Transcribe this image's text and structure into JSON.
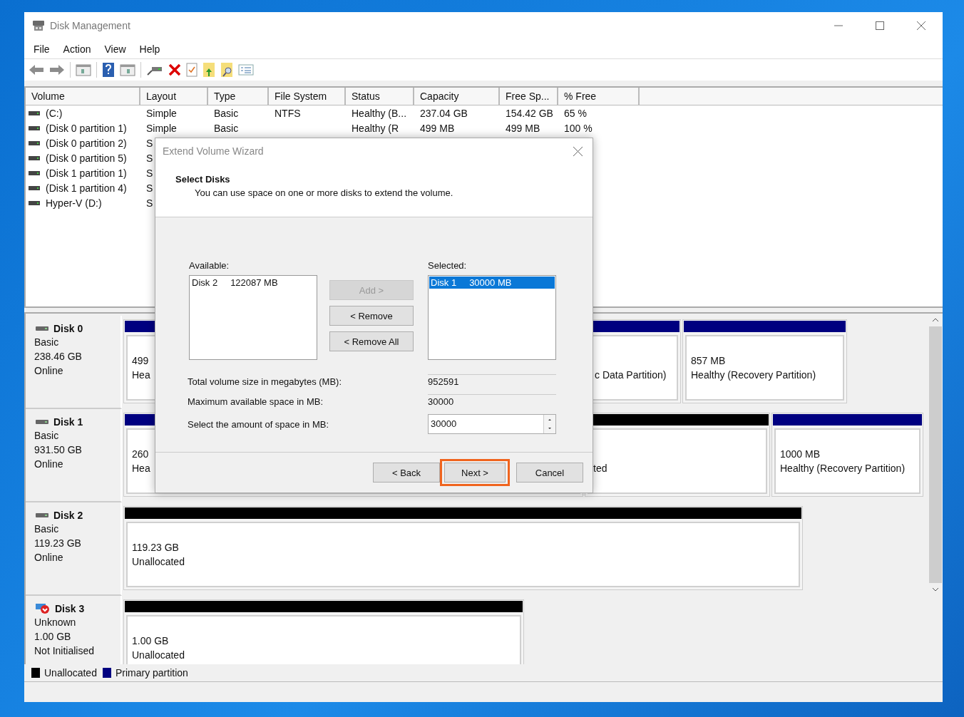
{
  "window": {
    "title": "Disk Management"
  },
  "menu": [
    "File",
    "Action",
    "View",
    "Help"
  ],
  "volumes": {
    "columns": [
      "Volume",
      "Layout",
      "Type",
      "File System",
      "Status",
      "Capacity",
      "Free Sp...",
      "% Free"
    ],
    "rows": [
      {
        "cells": [
          "(C:)",
          "Simple",
          "Basic",
          "NTFS",
          "Healthy (B...",
          "237.04 GB",
          "154.42 GB",
          "65 %"
        ]
      },
      {
        "cells": [
          "(Disk 0 partition 1)",
          "Simple",
          "Basic",
          "",
          "Healthy (R",
          "499 MB",
          "499 MB",
          "100 %"
        ]
      },
      {
        "cells": [
          "(Disk 0 partition 2)",
          "S"
        ]
      },
      {
        "cells": [
          "(Disk 0 partition 5)",
          "S"
        ]
      },
      {
        "cells": [
          "(Disk 1 partition 1)",
          "S"
        ]
      },
      {
        "cells": [
          "(Disk 1 partition 4)",
          "S"
        ]
      },
      {
        "cells": [
          "Hyper-V (D:)",
          "S"
        ]
      }
    ]
  },
  "disks": [
    {
      "name": "Disk 0",
      "kind": "online",
      "lines": [
        "Basic",
        "238.46 GB",
        "Online"
      ],
      "partitions": [
        {
          "color": "#000080",
          "size": "499",
          "status": "Hea"
        },
        {
          "color": "#000080",
          "status": "c Data Partition)"
        },
        {
          "color": "#000080",
          "size": "857 MB",
          "status": "Healthy (Recovery Partition)"
        }
      ]
    },
    {
      "name": "Disk 1",
      "kind": "online",
      "lines": [
        "Basic",
        "931.50 GB",
        "Online"
      ],
      "partitions": [
        {
          "color": "#000080",
          "size": "260",
          "status": "Hea"
        },
        {
          "color": "#000000",
          "status": "ted"
        },
        {
          "color": "#000080",
          "size": "1000 MB",
          "status": "Healthy (Recovery Partition)"
        }
      ]
    },
    {
      "name": "Disk 2",
      "kind": "online",
      "lines": [
        "Basic",
        "119.23 GB",
        "Online"
      ],
      "partitions": [
        {
          "color": "#000000",
          "size": "119.23 GB",
          "status": "Unallocated"
        }
      ]
    },
    {
      "name": "Disk 3",
      "kind": "not_initialized",
      "lines": [
        "Unknown",
        "1.00 GB",
        "Not Initialised"
      ],
      "partitions": [
        {
          "color": "#000000",
          "size": "1.00 GB",
          "status": "Unallocated"
        }
      ]
    }
  ],
  "legend": [
    {
      "label": "Unallocated",
      "color": "#000000"
    },
    {
      "label": "Primary partition",
      "color": "#000080"
    }
  ],
  "dialog": {
    "title": "Extend Volume Wizard",
    "heading": "Select Disks",
    "subheading": "You can use space on one or more disks to extend the volume.",
    "available_label": "Available:",
    "available": [
      {
        "disk": "Disk 2",
        "size": "122087 MB",
        "selected": false
      }
    ],
    "actions": [
      {
        "label": "Add >",
        "disabled": true
      },
      {
        "label": "< Remove",
        "disabled": false
      },
      {
        "label": "< Remove All",
        "disabled": false
      }
    ],
    "selected_label": "Selected:",
    "selected_list": [
      {
        "disk": "Disk 1",
        "size": "30000 MB",
        "selected": true
      }
    ],
    "fields": [
      {
        "label": "Total volume size in megabytes (MB):",
        "value": "952591",
        "kind": "readonly"
      },
      {
        "label": "Maximum available space in MB:",
        "value": "30000",
        "kind": "readonly"
      },
      {
        "label": "Select the amount of space in MB:",
        "value": "30000",
        "kind": "spin"
      }
    ],
    "buttons": [
      {
        "label": "< Back",
        "highlighted": false
      },
      {
        "label": "Next >",
        "highlighted": true
      },
      {
        "label": "Cancel",
        "highlighted": false
      }
    ]
  }
}
